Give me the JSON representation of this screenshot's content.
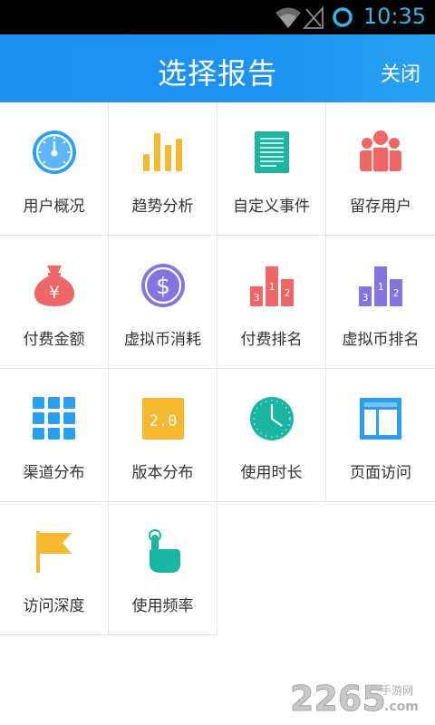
{
  "status_bar": {
    "time": "10:35",
    "wifi_icon": "wifi-icon",
    "signal_icon": "signal-icon",
    "sync_icon": "sync-icon"
  },
  "header": {
    "title": "选择报告",
    "close_label": "关闭"
  },
  "reports": [
    {
      "label": "用户概况",
      "icon": "gauge-icon"
    },
    {
      "label": "趋势分析",
      "icon": "bar-chart-icon"
    },
    {
      "label": "自定义事件",
      "icon": "document-icon"
    },
    {
      "label": "留存用户",
      "icon": "users-icon"
    },
    {
      "label": "付费金额",
      "icon": "money-bag-icon"
    },
    {
      "label": "虚拟币消耗",
      "icon": "dollar-coin-icon"
    },
    {
      "label": "付费排名",
      "icon": "podium-icon"
    },
    {
      "label": "虚拟币排名",
      "icon": "podium-icon"
    },
    {
      "label": "渠道分布",
      "icon": "grid-icon"
    },
    {
      "label": "版本分布",
      "icon": "version-icon",
      "icon_text": "2.0"
    },
    {
      "label": "使用时长",
      "icon": "clock-icon"
    },
    {
      "label": "页面访问",
      "icon": "layout-icon"
    },
    {
      "label": "访问深度",
      "icon": "flag-icon"
    },
    {
      "label": "使用频率",
      "icon": "hand-tap-icon"
    }
  ],
  "podium_digits": [
    "3",
    "1",
    "2"
  ],
  "watermark": {
    "number": "2265",
    "suffix": "手游网",
    "domain": ".com"
  },
  "colors": {
    "header": "#1f8ef1",
    "status_time": "#33b5e5",
    "blue": "#2a9ef0",
    "yellow": "#f5b82e",
    "teal": "#1ab5a3",
    "red": "#ef6666",
    "purple": "#8474e0",
    "grid_line": "#e3e3e3"
  }
}
